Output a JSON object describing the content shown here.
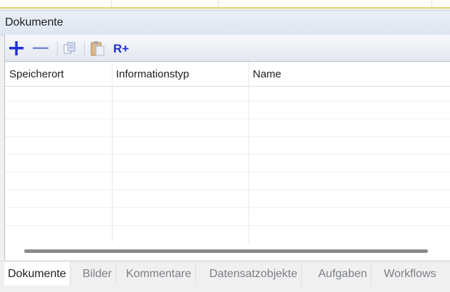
{
  "panel": {
    "title": "Dokumente"
  },
  "toolbar": {
    "buttons": [
      {
        "icon": "plus-icon",
        "label": "+"
      },
      {
        "icon": "minus-icon",
        "label": "—"
      },
      {
        "icon": "copy-icon"
      },
      {
        "icon": "paste-icon"
      },
      {
        "icon": "add-reference-icon",
        "label": "R+"
      }
    ]
  },
  "grid": {
    "columns": [
      "Speicherort",
      "Informationstyp",
      "Name"
    ],
    "rows": []
  },
  "tabs": [
    {
      "label": "Dokumente",
      "active": true
    },
    {
      "label": "Bilder"
    },
    {
      "label": "Kommentare"
    },
    {
      "label": "Datensatzobjekte"
    },
    {
      "label": "Aufgaben"
    },
    {
      "label": "Workflows"
    }
  ],
  "colors": {
    "accent_blue": "#1f2fd0",
    "header_bg": "#e3e9f2"
  }
}
